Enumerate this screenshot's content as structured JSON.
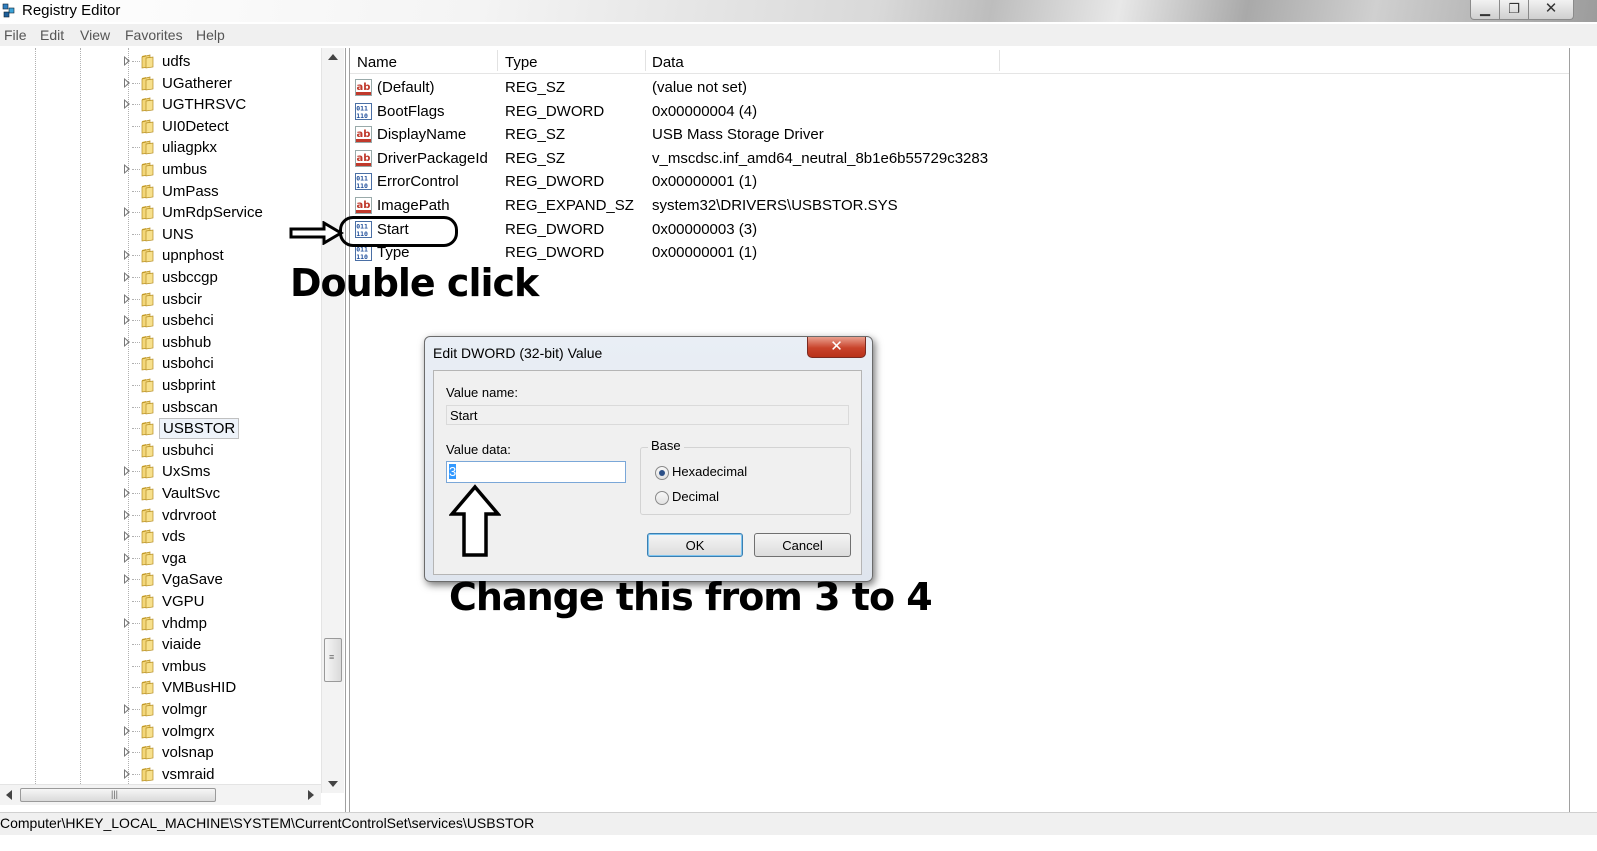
{
  "window": {
    "title": "Registry Editor"
  },
  "menu": [
    "File",
    "Edit",
    "Favorites",
    "Help"
  ],
  "tree": {
    "items": [
      {
        "label": "udfs",
        "expandable": true
      },
      {
        "label": "UGatherer",
        "expandable": true
      },
      {
        "label": "UGTHRSVC",
        "expandable": true
      },
      {
        "label": "UI0Detect",
        "expandable": false
      },
      {
        "label": "uliagpkx",
        "expandable": false
      },
      {
        "label": "umbus",
        "expandable": true
      },
      {
        "label": "UmPass",
        "expandable": false
      },
      {
        "label": "UmRdpService",
        "expandable": true
      },
      {
        "label": "UNS",
        "expandable": false
      },
      {
        "label": "upnphost",
        "expandable": true
      },
      {
        "label": "usbccgp",
        "expandable": true
      },
      {
        "label": "usbcir",
        "expandable": true
      },
      {
        "label": "usbehci",
        "expandable": true
      },
      {
        "label": "usbhub",
        "expandable": true
      },
      {
        "label": "usbohci",
        "expandable": false
      },
      {
        "label": "usbprint",
        "expandable": false
      },
      {
        "label": "usbscan",
        "expandable": false
      },
      {
        "label": "USBSTOR",
        "expandable": false,
        "selected": true
      },
      {
        "label": "usbuhci",
        "expandable": false
      },
      {
        "label": "UxSms",
        "expandable": true
      },
      {
        "label": "VaultSvc",
        "expandable": true
      },
      {
        "label": "vdrvroot",
        "expandable": true
      },
      {
        "label": "vds",
        "expandable": true
      },
      {
        "label": "vga",
        "expandable": true
      },
      {
        "label": "VgaSave",
        "expandable": true
      },
      {
        "label": "VGPU",
        "expandable": false
      },
      {
        "label": "vhdmp",
        "expandable": true
      },
      {
        "label": "viaide",
        "expandable": false
      },
      {
        "label": "vmbus",
        "expandable": false
      },
      {
        "label": "VMBusHID",
        "expandable": false
      },
      {
        "label": "volmgr",
        "expandable": true
      },
      {
        "label": "volmgrx",
        "expandable": true
      },
      {
        "label": "volsnap",
        "expandable": true
      },
      {
        "label": "vsmraid",
        "expandable": true
      }
    ]
  },
  "list": {
    "columns": [
      "Name",
      "Type",
      "Data"
    ],
    "rows": [
      {
        "icon": "string-value-icon",
        "name": "(Default)",
        "type": "REG_SZ",
        "data": "(value not set)"
      },
      {
        "icon": "dword-value-icon",
        "name": "BootFlags",
        "type": "REG_DWORD",
        "data": "0x00000004 (4)"
      },
      {
        "icon": "string-value-icon",
        "name": "DisplayName",
        "type": "REG_SZ",
        "data": "USB Mass Storage Driver"
      },
      {
        "icon": "string-value-icon",
        "name": "DriverPackageId",
        "type": "REG_SZ",
        "data": "v_mscdsc.inf_amd64_neutral_8b1e6b55729c3283"
      },
      {
        "icon": "dword-value-icon",
        "name": "ErrorControl",
        "type": "REG_DWORD",
        "data": "0x00000001 (1)"
      },
      {
        "icon": "string-value-icon",
        "name": "ImagePath",
        "type": "REG_EXPAND_SZ",
        "data": "system32\\DRIVERS\\USBSTOR.SYS"
      },
      {
        "icon": "dword-value-icon",
        "name": "Start",
        "type": "REG_DWORD",
        "data": "0x00000003 (3)"
      },
      {
        "icon": "dword-value-icon",
        "name": "Type",
        "type": "REG_DWORD",
        "data": "0x00000001 (1)"
      }
    ]
  },
  "annotations": {
    "double_click": "Double click",
    "change_note": "Change this from 3 to 4"
  },
  "dialog": {
    "title": "Edit DWORD (32-bit) Value",
    "close_glyph": "✕",
    "value_name_label": "Value name:",
    "value_name": "Start",
    "value_data_label": "Value data:",
    "value_data": "3",
    "base_label": "Base",
    "base_options": [
      "Hexadecimal",
      "Decimal"
    ],
    "base_selected": "Hexadecimal",
    "ok_label": "OK",
    "cancel_label": "Cancel"
  },
  "status": {
    "path": "Computer\\HKEY_LOCAL_MACHINE\\SYSTEM\\CurrentControlSet\\services\\USBSTOR"
  },
  "colors": {
    "selection": "#3399ff",
    "dialog_close": "#c8432b",
    "menu_text": "#555555"
  }
}
